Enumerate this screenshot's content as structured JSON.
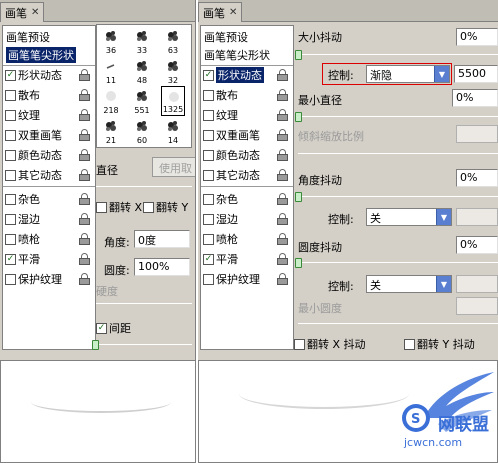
{
  "left": {
    "tab_title": "画笔",
    "sidebar_items": [
      {
        "label": "画笔预设",
        "checked": false,
        "has_checkbox": false,
        "has_lock": false
      },
      {
        "label": "画笔笔尖形状",
        "checked": false,
        "has_checkbox": false,
        "has_lock": false,
        "selected": true
      },
      {
        "label": "形状动态",
        "checked": true,
        "has_checkbox": true,
        "has_lock": true
      },
      {
        "label": "散布",
        "checked": false,
        "has_checkbox": true,
        "has_lock": true
      },
      {
        "label": "纹理",
        "checked": false,
        "has_checkbox": true,
        "has_lock": true
      },
      {
        "label": "双重画笔",
        "checked": false,
        "has_checkbox": true,
        "has_lock": true
      },
      {
        "label": "颜色动态",
        "checked": false,
        "has_checkbox": true,
        "has_lock": true
      },
      {
        "label": "其它动态",
        "checked": false,
        "has_checkbox": true,
        "has_lock": true
      },
      {
        "label": "杂色",
        "checked": false,
        "has_checkbox": true,
        "has_lock": true
      },
      {
        "label": "湿边",
        "checked": false,
        "has_checkbox": true,
        "has_lock": true
      },
      {
        "label": "喷枪",
        "checked": false,
        "has_checkbox": true,
        "has_lock": true
      },
      {
        "label": "平滑",
        "checked": true,
        "has_checkbox": true,
        "has_lock": true
      },
      {
        "label": "保护纹理",
        "checked": false,
        "has_checkbox": true,
        "has_lock": true
      }
    ],
    "brushes": [
      {
        "size": "36"
      },
      {
        "size": "33"
      },
      {
        "size": "63"
      },
      {
        "size": "11"
      },
      {
        "size": "48"
      },
      {
        "size": "32"
      },
      {
        "size": "218"
      },
      {
        "size": "551"
      },
      {
        "size": "1325"
      },
      {
        "size": "21"
      },
      {
        "size": "60"
      },
      {
        "size": "14"
      }
    ],
    "diameter_label": "直径",
    "use_sample_button": "使用取",
    "flip_x_label": "翻转 X",
    "flip_y_label": "翻转 Y",
    "angle_label": "角度:",
    "angle_value": "0度",
    "roundness_label": "圆度:",
    "roundness_value": "100%",
    "hardness_label": "硬度",
    "spacing_label": "间距",
    "spacing_checked": true
  },
  "right": {
    "tab_title": "画笔",
    "sidebar_items": [
      {
        "label": "画笔预设",
        "checked": false,
        "has_checkbox": false,
        "has_lock": false
      },
      {
        "label": "画笔笔尖形状",
        "checked": false,
        "has_checkbox": false,
        "has_lock": false
      },
      {
        "label": "形状动态",
        "checked": true,
        "has_checkbox": true,
        "has_lock": true,
        "selected": true
      },
      {
        "label": "散布",
        "checked": false,
        "has_checkbox": true,
        "has_lock": true
      },
      {
        "label": "纹理",
        "checked": false,
        "has_checkbox": true,
        "has_lock": true
      },
      {
        "label": "双重画笔",
        "checked": false,
        "has_checkbox": true,
        "has_lock": true
      },
      {
        "label": "颜色动态",
        "checked": false,
        "has_checkbox": true,
        "has_lock": true
      },
      {
        "label": "其它动态",
        "checked": false,
        "has_checkbox": true,
        "has_lock": true
      },
      {
        "label": "杂色",
        "checked": false,
        "has_checkbox": true,
        "has_lock": true
      },
      {
        "label": "湿边",
        "checked": false,
        "has_checkbox": true,
        "has_lock": true
      },
      {
        "label": "喷枪",
        "checked": false,
        "has_checkbox": true,
        "has_lock": true
      },
      {
        "label": "平滑",
        "checked": true,
        "has_checkbox": true,
        "has_lock": true
      },
      {
        "label": "保护纹理",
        "checked": false,
        "has_checkbox": true,
        "has_lock": true
      }
    ],
    "size_jitter_label": "大小抖动",
    "size_jitter_value": "0%",
    "control_label": "控制:",
    "control_fade_value": "渐隐",
    "fade_steps_value": "5500",
    "min_diameter_label": "最小直径",
    "min_diameter_value": "0%",
    "tilt_scale_label": "倾斜缩放比例",
    "angle_jitter_label": "角度抖动",
    "angle_jitter_value": "0%",
    "angle_control_label": "控制:",
    "angle_control_value": "关",
    "roundness_jitter_label": "圆度抖动",
    "roundness_jitter_value": "0%",
    "roundness_control_label": "控制:",
    "roundness_control_value": "关",
    "min_roundness_label": "最小圆度",
    "flip_x_jitter_label": "翻转 X 抖动",
    "flip_y_jitter_label": "翻转 Y 抖动"
  },
  "watermark": {
    "text": "jcwcn.com",
    "chars": "网联盟"
  },
  "colors": {
    "panel_bg": "#d4d0c8",
    "selection": "#0a246a",
    "highlight_box": "#dd0000",
    "watermark_blue": "#3a6fd8"
  }
}
